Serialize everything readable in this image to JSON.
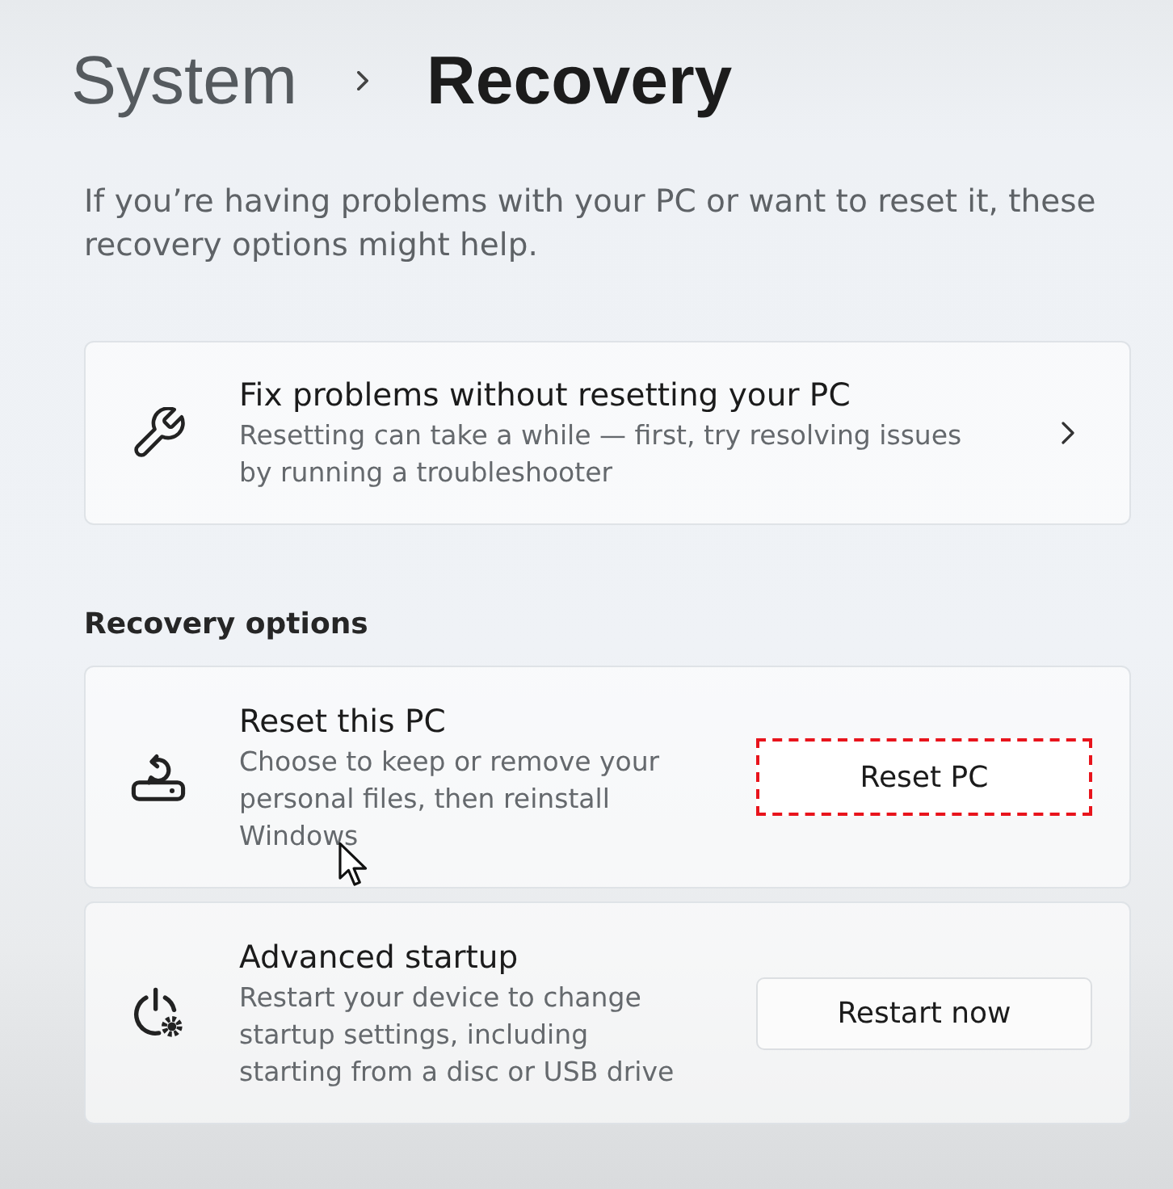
{
  "breadcrumb": {
    "parent": "System",
    "current": "Recovery"
  },
  "description": "If you’re having problems with your PC or want to reset it, these recovery options might help.",
  "troubleshoot_card": {
    "title": "Fix problems without resetting your PC",
    "description": "Resetting can take a while — first, try resolving issues by running a troubleshooter"
  },
  "section_heading": "Recovery options",
  "options": [
    {
      "kind": "reset",
      "title": "Reset this PC",
      "description": "Choose to keep or remove your personal files, then reinstall Windows",
      "button": {
        "label": "Reset PC",
        "highlighted": true
      }
    },
    {
      "kind": "advanced",
      "title": "Advanced startup",
      "description": "Restart your device to change startup settings, including starting from a disc or USB drive",
      "button": {
        "label": "Restart now",
        "highlighted": false
      }
    }
  ]
}
